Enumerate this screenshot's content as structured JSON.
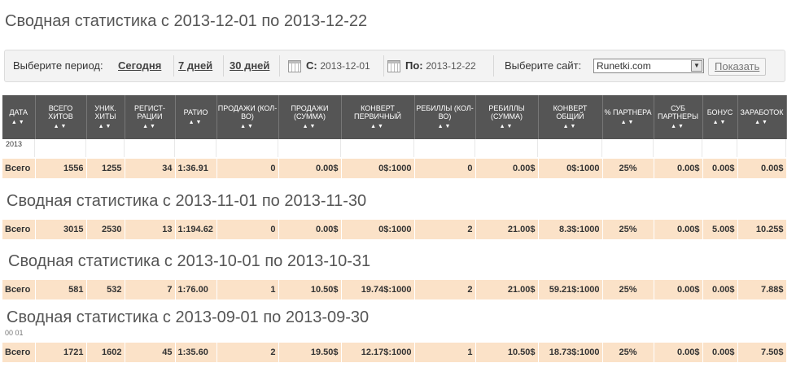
{
  "sections": [
    {
      "title": "Сводная статистика с 2013-12-01 по 2013-12-22"
    },
    {
      "title": "Сводная статистика с 2013-11-01 по 2013-11-30"
    },
    {
      "title": "Сводная статистика с 2013-10-01 по 2013-10-31"
    },
    {
      "title": "Сводная статистика с 2013-09-01 по 2013-09-30"
    }
  ],
  "filter": {
    "period_label": "Выберите период:",
    "today": "Сегодня",
    "week": "7 дней",
    "month": "30 дней",
    "from_label": "С:",
    "from_value": "2013-12-01",
    "to_label": "По:",
    "to_value": "2013-12-22",
    "site_label": "Выберите сайт:",
    "site_value": "Runetki.com",
    "show_button": "Показать"
  },
  "columns": [
    "ДАТА",
    "ВСЕГО ХИТОВ",
    "УНИК. ХИТЫ",
    "РЕГИСТ- РАЦИИ",
    "РАТИО",
    "ПРОДАЖИ (КОЛ-ВО)",
    "ПРОДАЖИ (СУММА)",
    "КОНВЕРТ ПЕРВИЧНЫЙ",
    "РЕБИЛЛЫ (КОЛ-ВО)",
    "РЕБИЛЛЫ (СУММА)",
    "КОНВЕРТ ОБЩИЙ",
    "% ПАРТНЕРА",
    "СУБ ПАРТНЕРЫ",
    "БОНУС",
    "ЗАРАБОТОК"
  ],
  "ghost_text": "2013",
  "ghost_text2": "00 01",
  "totals": [
    [
      "Всего",
      "1556",
      "1255",
      "34",
      "1:36.91",
      "0",
      "0.00$",
      "0$:1000",
      "0",
      "0.00$",
      "0$:1000",
      "25%",
      "0.00$",
      "0.00$",
      "0.00$"
    ],
    [
      "Всего",
      "3015",
      "2530",
      "13",
      "1:194.62",
      "0",
      "0.00$",
      "0$:1000",
      "2",
      "21.00$",
      "8.3$:1000",
      "25%",
      "0.00$",
      "5.00$",
      "10.25$"
    ],
    [
      "Всего",
      "581",
      "532",
      "7",
      "1:76.00",
      "1",
      "10.50$",
      "19.74$:1000",
      "2",
      "21.00$",
      "59.21$:1000",
      "25%",
      "0.00$",
      "0.00$",
      "7.88$"
    ],
    [
      "Всего",
      "1721",
      "1602",
      "45",
      "1:35.60",
      "2",
      "19.50$",
      "12.17$:1000",
      "1",
      "10.50$",
      "18.73$:1000",
      "25%",
      "0.00$",
      "0.00$",
      "7.50$"
    ]
  ],
  "colors": {
    "header_bg": "#555555",
    "total_bg": "#fbe2c8",
    "filter_bg": "#f3f3f3"
  }
}
